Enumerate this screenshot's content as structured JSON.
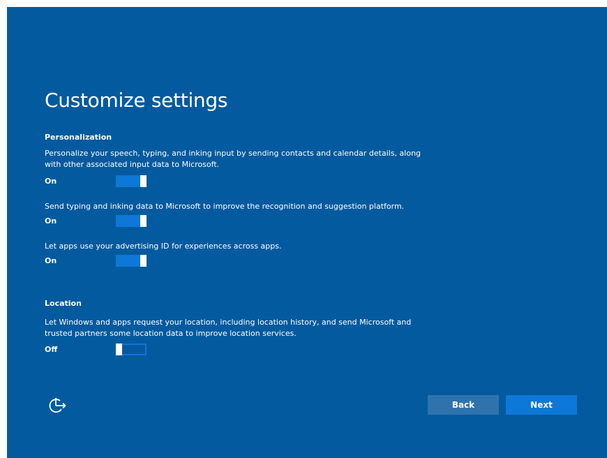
{
  "page": {
    "title": "Customize settings"
  },
  "sections": {
    "personalization": {
      "heading": "Personalization",
      "settings": [
        {
          "description": "Personalize your speech, typing, and inking input by sending contacts and calendar details, along with other associated input data to Microsoft.",
          "state": "On"
        },
        {
          "description": "Send typing and inking data to Microsoft to improve the recognition and suggestion platform.",
          "state": "On"
        },
        {
          "description": "Let apps use your advertising ID for experiences across apps.",
          "state": "On"
        }
      ]
    },
    "location": {
      "heading": "Location",
      "settings": [
        {
          "description": "Let Windows and apps request your location, including location history, and send Microsoft and trusted partners some location data to improve location services.",
          "state": "Off"
        }
      ]
    }
  },
  "footer": {
    "ease_of_access_icon": "ease-of-access-icon",
    "back_label": "Back",
    "next_label": "Next"
  },
  "colors": {
    "background": "#045a9f",
    "accent": "#0d78d7",
    "back_button": "#2f73ad",
    "text": "#ffffff"
  }
}
